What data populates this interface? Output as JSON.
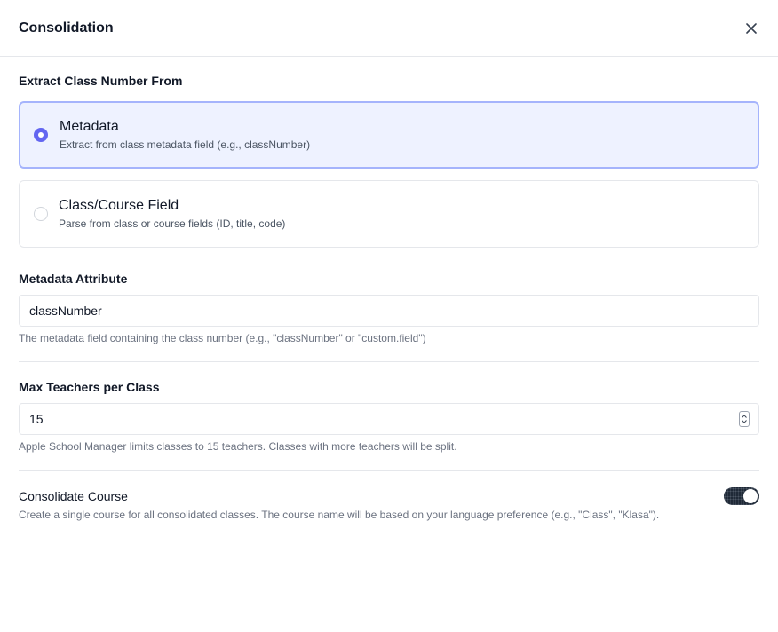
{
  "dialog": {
    "title": "Consolidation",
    "close_icon": "close-icon"
  },
  "extract": {
    "label": "Extract Class Number From",
    "options": [
      {
        "title": "Metadata",
        "description": "Extract from class metadata field (e.g., classNumber)",
        "selected": true
      },
      {
        "title": "Class/Course Field",
        "description": "Parse from class or course fields (ID, title, code)",
        "selected": false
      }
    ]
  },
  "metadata_attribute": {
    "label": "Metadata Attribute",
    "value": "classNumber",
    "help": "The metadata field containing the class number (e.g., \"classNumber\" or \"custom.field\")"
  },
  "max_teachers": {
    "label": "Max Teachers per Class",
    "value": "15",
    "help": "Apple School Manager limits classes to 15 teachers. Classes with more teachers will be split."
  },
  "consolidate_course": {
    "label": "Consolidate Course",
    "description": "Create a single course for all consolidated classes. The course name will be based on your language preference (e.g., \"Class\", \"Klasa\").",
    "enabled": true
  },
  "colors": {
    "accent": "#6366f1",
    "selected_bg": "#eef2ff",
    "selected_border": "#a5b4fc",
    "toggle_on": "#1f2937"
  }
}
